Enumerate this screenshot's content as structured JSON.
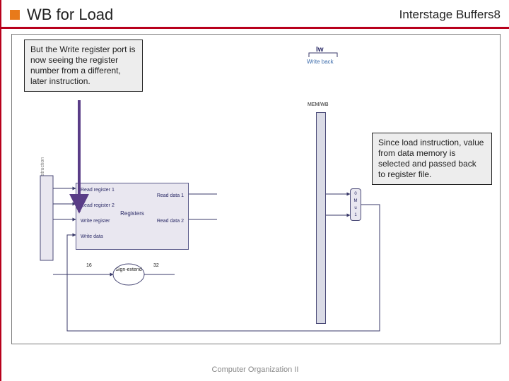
{
  "header": {
    "title": "WB for Load",
    "subtitle": "Interstage Buffers",
    "page": "8"
  },
  "notes": {
    "left": "But the Write register port is now seeing the register number from a different, later instruction.",
    "right": "Since load instruction, value from data memory is selected and passed back to register file."
  },
  "diagram": {
    "iw": "Iw",
    "writeback": "Write back",
    "memwb": "MEM/WB",
    "signextend": "Sign-extend",
    "sixteen": "16",
    "thirtytwo": "32",
    "instmem": "Instruction",
    "mux": {
      "zero": "0",
      "m": "M",
      "u": "u",
      "x": "x",
      "one": "1"
    },
    "regfile": {
      "name": "Registers",
      "rr1": "Read register 1",
      "rr2": "Read register 2",
      "wr": "Write register",
      "wd": "Write data",
      "rd1": "Read data 1",
      "rd2": "Read data 2"
    }
  },
  "footer": "Computer Organization II"
}
